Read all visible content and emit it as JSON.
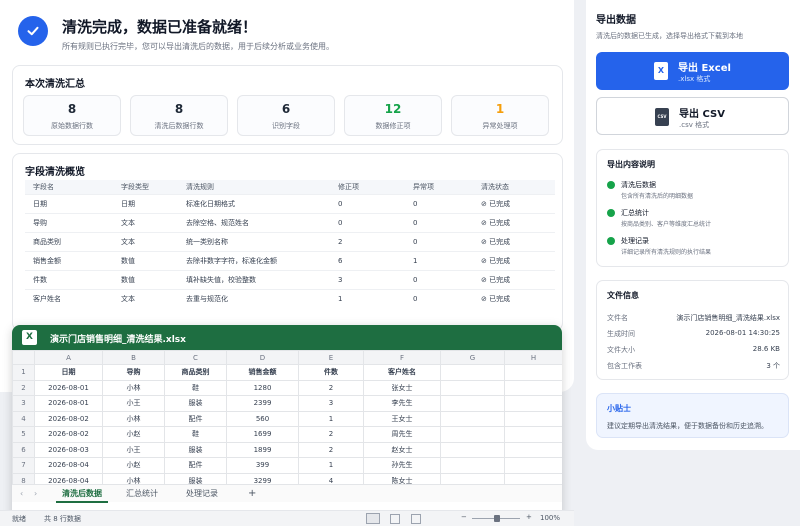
{
  "hero": {
    "title": "清洗完成，数据已准备就绪！",
    "subtitle": "所有规则已执行完毕，您可以导出清洗后的数据，用于后续分析或业务使用。"
  },
  "summary": {
    "title": "本次清洗汇总",
    "stats": [
      {
        "value": "8",
        "label": "原始数据行数",
        "color": "#111827"
      },
      {
        "value": "8",
        "label": "清洗后数据行数",
        "color": "#111827"
      },
      {
        "value": "6",
        "label": "识别字段",
        "color": "#111827"
      },
      {
        "value": "12",
        "label": "数据修正项",
        "color": "#16a34a"
      },
      {
        "value": "1",
        "label": "异常处理项",
        "color": "#f59e0b"
      }
    ]
  },
  "fields": {
    "title": "字段清洗概览",
    "headers": [
      "字段名",
      "字段类型",
      "清洗规则",
      "修正项",
      "异常项",
      "清洗状态"
    ],
    "rows": [
      [
        "日期",
        "日期",
        "标准化日期格式",
        "0",
        "0",
        "已完成"
      ],
      [
        "导购",
        "文本",
        "去除空格、规范姓名",
        "0",
        "0",
        "已完成"
      ],
      [
        "商品类别",
        "文本",
        "统一类别名称",
        "2",
        "0",
        "已完成"
      ],
      [
        "销售金额",
        "数值",
        "去除非数字字符，标准化金额",
        "6",
        "1",
        "已完成"
      ],
      [
        "件数",
        "数值",
        "填补缺失值，校验整数",
        "3",
        "0",
        "已完成"
      ],
      [
        "客户姓名",
        "文本",
        "去重与规范化",
        "1",
        "0",
        "已完成"
      ]
    ]
  },
  "excel": {
    "icon": "X",
    "filename": "演示门店销售明细_清洗结果.xlsx",
    "col_letters": [
      "A",
      "B",
      "C",
      "D",
      "E",
      "F",
      "G",
      "H"
    ],
    "rows": [
      [
        "1",
        "日期",
        "导购",
        "商品类别",
        "销售金额",
        "件数",
        "客户姓名",
        "",
        ""
      ],
      [
        "2",
        "2026-08-01",
        "小林",
        "鞋",
        "1280",
        "2",
        "张女士",
        "",
        ""
      ],
      [
        "3",
        "2026-08-01",
        "小王",
        "服装",
        "2399",
        "3",
        "李先生",
        "",
        ""
      ],
      [
        "4",
        "2026-08-02",
        "小林",
        "配件",
        "560",
        "1",
        "王女士",
        "",
        ""
      ],
      [
        "5",
        "2026-08-02",
        "小赵",
        "鞋",
        "1699",
        "2",
        "周先生",
        "",
        ""
      ],
      [
        "6",
        "2026-08-03",
        "小王",
        "服装",
        "1899",
        "2",
        "赵女士",
        "",
        ""
      ],
      [
        "7",
        "2026-08-04",
        "小赵",
        "配件",
        "399",
        "1",
        "孙先生",
        "",
        ""
      ],
      [
        "8",
        "2026-08-04",
        "小林",
        "服装",
        "3299",
        "4",
        "陈女士",
        "",
        ""
      ]
    ],
    "sheet_tabs": [
      "清洗后数据",
      "汇总统计",
      "处理记录"
    ],
    "add_sheet": "+",
    "status_ready": "就绪",
    "status_count": "共 8 行数据",
    "zoom": "100%"
  },
  "export": {
    "title": "导出数据",
    "subtitle": "清洗后的数据已生成，选择导出格式下载到本地",
    "excel_label": "导出 Excel",
    "excel_ext": ".xlsx 格式",
    "csv_label": "导出 CSV",
    "csv_ext": ".csv 格式",
    "csv_icon": "CSV"
  },
  "explain": {
    "title": "导出内容说明",
    "items": [
      {
        "title": "清洗后数据",
        "desc": "包含所有清洗后的明细数据"
      },
      {
        "title": "汇总统计",
        "desc": "按商品类别、客户等维度汇总统计"
      },
      {
        "title": "处理记录",
        "desc": "详细记录所有清洗规则的执行结果"
      }
    ]
  },
  "fileinfo": {
    "title": "文件信息",
    "items": [
      {
        "k": "文件名",
        "v": "演示门店销售明细_清洗结果.xlsx"
      },
      {
        "k": "生成时间",
        "v": "2026-08-01 14:30:25"
      },
      {
        "k": "文件大小",
        "v": "28.6 KB"
      },
      {
        "k": "包含工作表",
        "v": "3 个"
      }
    ]
  },
  "tip": {
    "title": "小贴士",
    "text": "建议定期导出清洗结果，便于数据备份和历史追溯。"
  },
  "colors": {
    "accent": "#2563eb",
    "excel_green": "#1e6e41",
    "success": "#16a34a",
    "warning": "#f59e0b"
  }
}
